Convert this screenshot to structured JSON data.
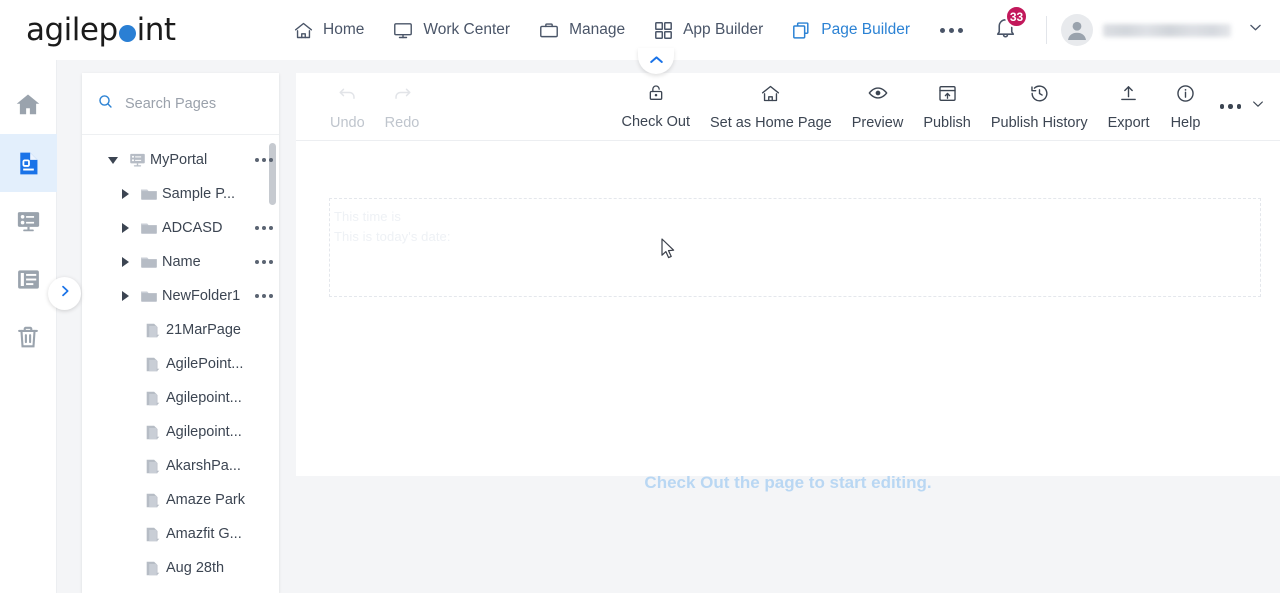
{
  "app": {
    "brand_primary": "#2a7fd4",
    "brand_name_part1": "agilep",
    "brand_name_part2": "int"
  },
  "header": {
    "nav": [
      {
        "label": "Home",
        "icon": "home-icon",
        "active": false
      },
      {
        "label": "Work Center",
        "icon": "monitor-icon",
        "active": false
      },
      {
        "label": "Manage",
        "icon": "briefcase-icon",
        "active": false
      },
      {
        "label": "App Builder",
        "icon": "grid-icon",
        "active": false
      },
      {
        "label": "Page Builder",
        "icon": "copy-pages-icon",
        "active": true
      }
    ],
    "overflow_icon": "ellipsis-icon",
    "notifications": {
      "icon": "bell-icon",
      "count": "33",
      "badge_color": "#c2185b"
    },
    "user": {
      "avatar_icon": "avatar-icon",
      "name": "",
      "chevron": "chevron-down-icon"
    }
  },
  "rail": {
    "items": [
      {
        "name": "home",
        "icon": "home-filled-icon",
        "active": false
      },
      {
        "name": "pages",
        "icon": "page-document-icon",
        "active": true
      },
      {
        "name": "portal",
        "icon": "portal-layout-icon",
        "active": false
      },
      {
        "name": "list",
        "icon": "list-panel-icon",
        "active": false
      },
      {
        "name": "recycle-bin",
        "icon": "trash-icon",
        "active": false
      }
    ],
    "collapse_icon": "chevron-right-icon"
  },
  "tree": {
    "search": {
      "placeholder": "Search Pages",
      "icon": "search-icon",
      "value": ""
    },
    "items": [
      {
        "label": "MyPortal",
        "depth": 0,
        "type": "portal",
        "icon": "portal-icon",
        "caret": "down",
        "dots": true
      },
      {
        "label": "Sample P...",
        "depth": 1,
        "type": "folder",
        "icon": "folder-icon",
        "caret": "right",
        "dots": false
      },
      {
        "label": "ADCASD",
        "depth": 1,
        "type": "folder",
        "icon": "folder-icon",
        "caret": "right",
        "dots": true
      },
      {
        "label": "Name",
        "depth": 1,
        "type": "folder",
        "icon": "folder-icon",
        "caret": "right",
        "dots": true
      },
      {
        "label": "NewFolder1",
        "depth": 1,
        "type": "folder",
        "icon": "folder-icon",
        "caret": "right",
        "dots": true
      },
      {
        "label": "21MarPage",
        "depth": 1,
        "type": "page",
        "icon": "page-icon",
        "caret": "none",
        "dots": false
      },
      {
        "label": "AgilePoint...",
        "depth": 1,
        "type": "page",
        "icon": "page-icon",
        "caret": "none",
        "dots": false
      },
      {
        "label": "Agilepoint...",
        "depth": 1,
        "type": "page",
        "icon": "page-icon",
        "caret": "none",
        "dots": false
      },
      {
        "label": "Agilepoint...",
        "depth": 1,
        "type": "page",
        "icon": "page-icon",
        "caret": "none",
        "dots": false
      },
      {
        "label": "AkarshPa...",
        "depth": 1,
        "type": "page",
        "icon": "page-icon",
        "caret": "none",
        "dots": false
      },
      {
        "label": "Amaze Park",
        "depth": 1,
        "type": "page",
        "icon": "page-icon",
        "caret": "none",
        "dots": false
      },
      {
        "label": "Amazfit G...",
        "depth": 1,
        "type": "page",
        "icon": "page-icon",
        "caret": "none",
        "dots": false
      },
      {
        "label": "Aug 28th",
        "depth": 1,
        "type": "page",
        "icon": "page-icon",
        "caret": "none",
        "dots": false
      }
    ]
  },
  "toolbar": {
    "collapse_tab_icon": "chevron-up-icon",
    "buttons": [
      {
        "label": "Undo",
        "icon": "undo-icon",
        "disabled": true
      },
      {
        "label": "Redo",
        "icon": "redo-icon",
        "disabled": true
      },
      {
        "label": "Check Out",
        "icon": "lock-icon",
        "disabled": false
      },
      {
        "label": "Set as Home Page",
        "icon": "home-outline-icon",
        "disabled": false
      },
      {
        "label": "Preview",
        "icon": "eye-icon",
        "disabled": false
      },
      {
        "label": "Publish",
        "icon": "publish-layout-icon",
        "disabled": false
      },
      {
        "label": "Publish History",
        "icon": "history-clock-icon",
        "disabled": false
      },
      {
        "label": "Export",
        "icon": "upload-icon",
        "disabled": false
      },
      {
        "label": "Help",
        "icon": "info-circle-icon",
        "disabled": false
      }
    ],
    "more_icon": "ellipsis-icon",
    "more_chevron_icon": "chevron-down-icon"
  },
  "canvas": {
    "ghost_lines": [
      "This time is",
      "This is today's date:"
    ],
    "message": "Check Out the page to start editing.",
    "message_color": "#b9d7f3"
  }
}
